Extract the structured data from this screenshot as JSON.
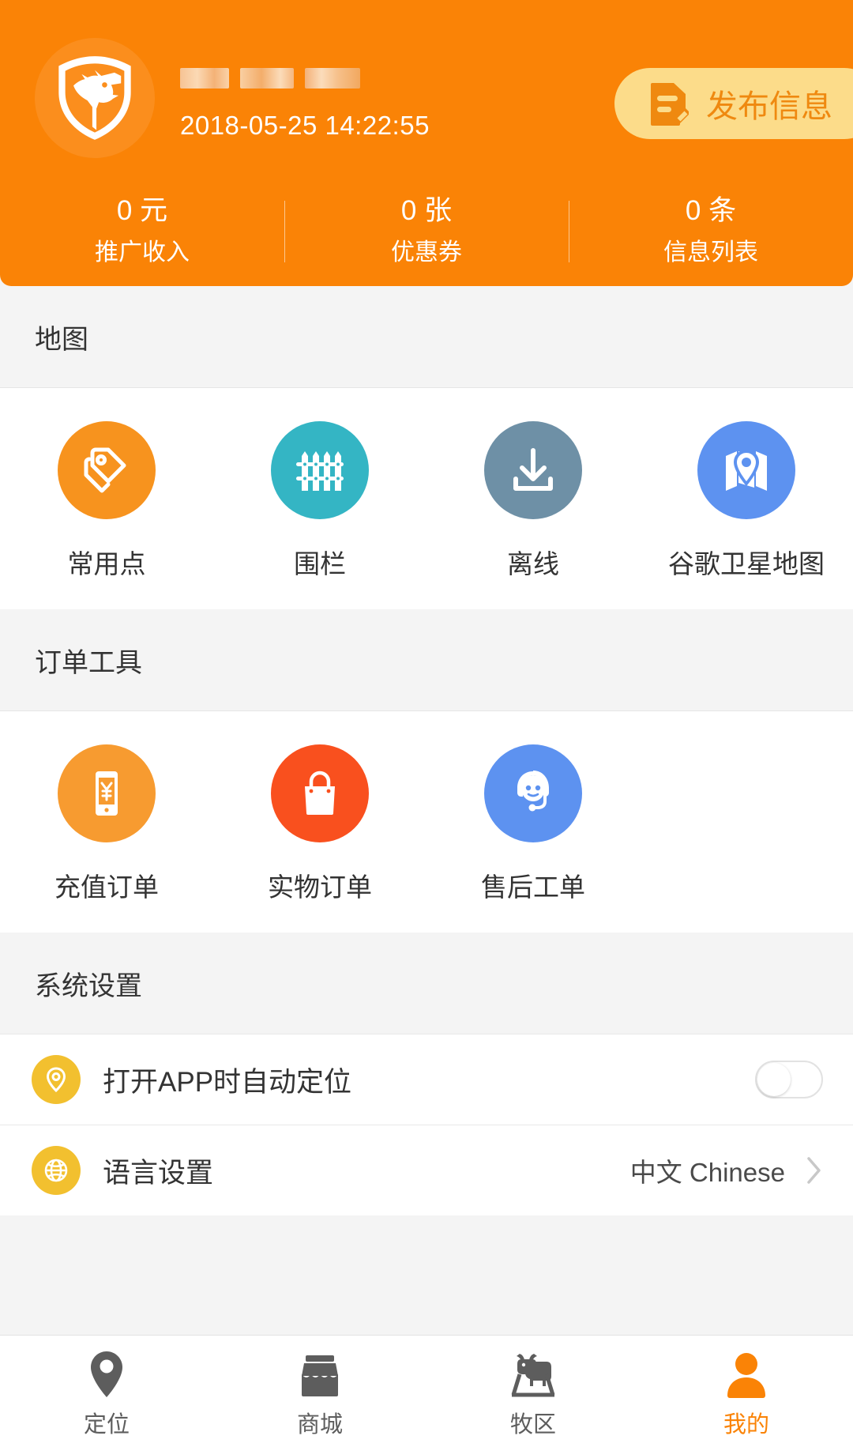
{
  "header": {
    "avatar_icon": "shield-horse-logo",
    "username_masked": "",
    "datetime": "2018-05-25 14:22:55",
    "publish_button": {
      "label": "发布信息",
      "icon": "document-edit-icon"
    },
    "background_color": "#fa8306",
    "stats": [
      {
        "value": "0 元",
        "label": "推广收入"
      },
      {
        "value": "0 张",
        "label": "优惠券"
      },
      {
        "value": "0 条",
        "label": "信息列表"
      }
    ]
  },
  "sections": [
    {
      "title": "地图",
      "items": [
        {
          "label": "常用点",
          "icon": "price-tags-icon",
          "color": "#f7931e"
        },
        {
          "label": "围栏",
          "icon": "fence-icon",
          "color": "#34b5c4"
        },
        {
          "label": "离线",
          "icon": "download-icon",
          "color": "#6e90a6"
        },
        {
          "label": "谷歌卫星地图",
          "icon": "map-pin-icon",
          "color": "#5d92f0"
        }
      ]
    },
    {
      "title": "订单工具",
      "items": [
        {
          "label": "充值订单",
          "icon": "phone-yuan-icon",
          "color": "#f79b30"
        },
        {
          "label": "实物订单",
          "icon": "shopping-bag-icon",
          "color": "#f9501e"
        },
        {
          "label": "售后工单",
          "icon": "customer-service-icon",
          "color": "#5d92f0"
        }
      ]
    }
  ],
  "settings": {
    "title": "系统设置",
    "rows": [
      {
        "label": "打开APP时自动定位",
        "icon": "location-pin-icon",
        "control": "toggle",
        "value": "off"
      },
      {
        "label": "语言设置",
        "icon": "globe-icon",
        "control": "chevron",
        "value": "中文 Chinese"
      }
    ],
    "icon_color": "#f2c02f"
  },
  "bottom_nav": {
    "active_color": "#fa8306",
    "inactive_color": "#5d5d5d",
    "items": [
      {
        "label": "定位",
        "icon": "location-pin-icon",
        "active": false
      },
      {
        "label": "商城",
        "icon": "store-icon",
        "active": false
      },
      {
        "label": "牧区",
        "icon": "cattle-pasture-icon",
        "active": false
      },
      {
        "label": "我的",
        "icon": "person-icon",
        "active": true
      }
    ]
  }
}
